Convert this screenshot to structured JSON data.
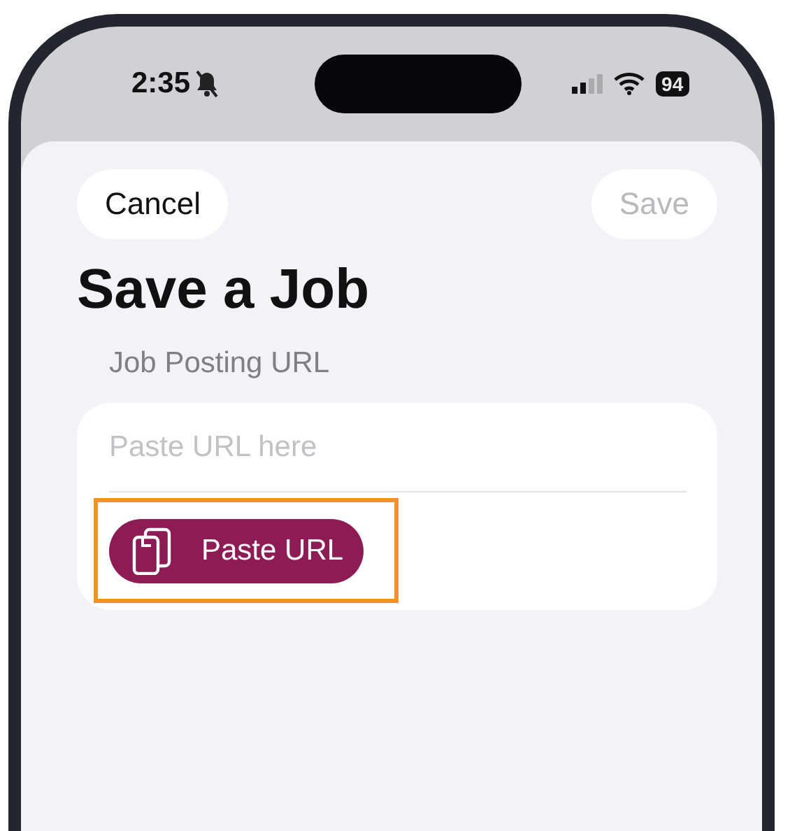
{
  "status_bar": {
    "time": "2:35",
    "silent": true,
    "battery": "94"
  },
  "nav": {
    "cancel": {
      "label": "Cancel",
      "disabled": false
    },
    "save": {
      "label": "Save",
      "disabled": true
    }
  },
  "title": "Save a Job",
  "field": {
    "label": "Job Posting URL",
    "placeholder": "Paste URL here"
  },
  "paste_button": {
    "label": "Paste URL",
    "highlighted": true
  }
}
